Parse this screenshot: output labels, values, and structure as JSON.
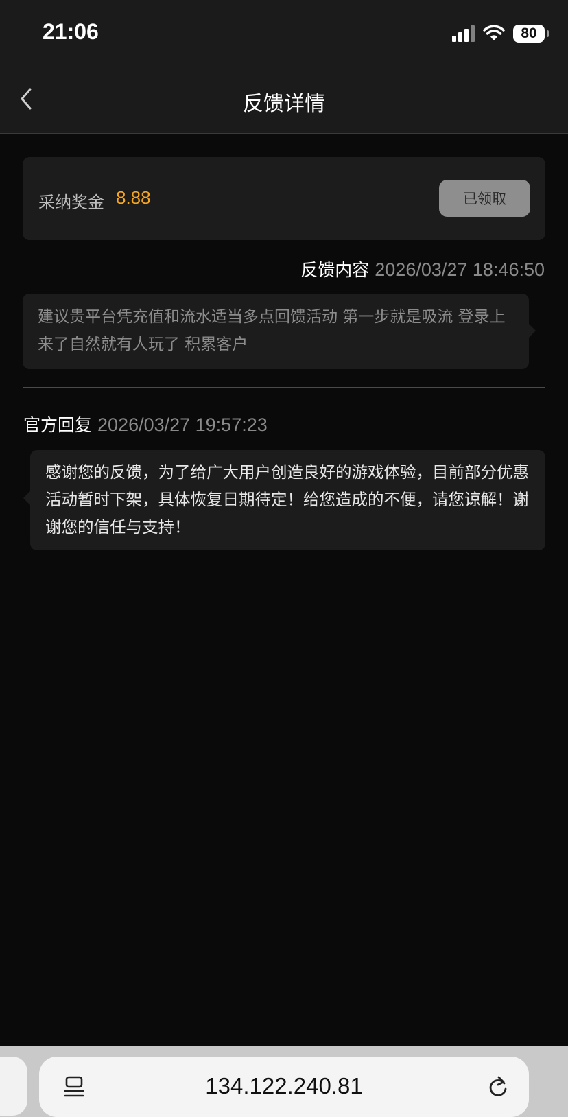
{
  "status_bar": {
    "time": "21:06",
    "battery": "80",
    "icons": [
      "signal-icon",
      "wifi-icon",
      "battery-icon"
    ]
  },
  "nav": {
    "title": "反馈详情",
    "back_icon": "chevron-left-icon"
  },
  "reward": {
    "label": "采纳奖金",
    "amount": "8.88",
    "button_label": "已领取",
    "amount_color": "#f5a623"
  },
  "feedback": {
    "label": "反馈内容",
    "time": "2026/03/27 18:46:50",
    "content": "建议贵平台凭充值和流水适当多点回馈活动 第一步就是吸流 登录上来了自然就有人玩了 积累客户"
  },
  "reply": {
    "label": "官方回复",
    "time": "2026/03/27 19:57:23",
    "content": "感谢您的反馈，为了给广大用户创造良好的游戏体验，目前部分优惠活动暂时下架，具体恢复日期待定！给您造成的不便，请您谅解！谢谢您的信任与支持！"
  },
  "browser": {
    "url": "134.122.240.81",
    "icons": [
      "reader-icon",
      "reload-icon"
    ]
  }
}
